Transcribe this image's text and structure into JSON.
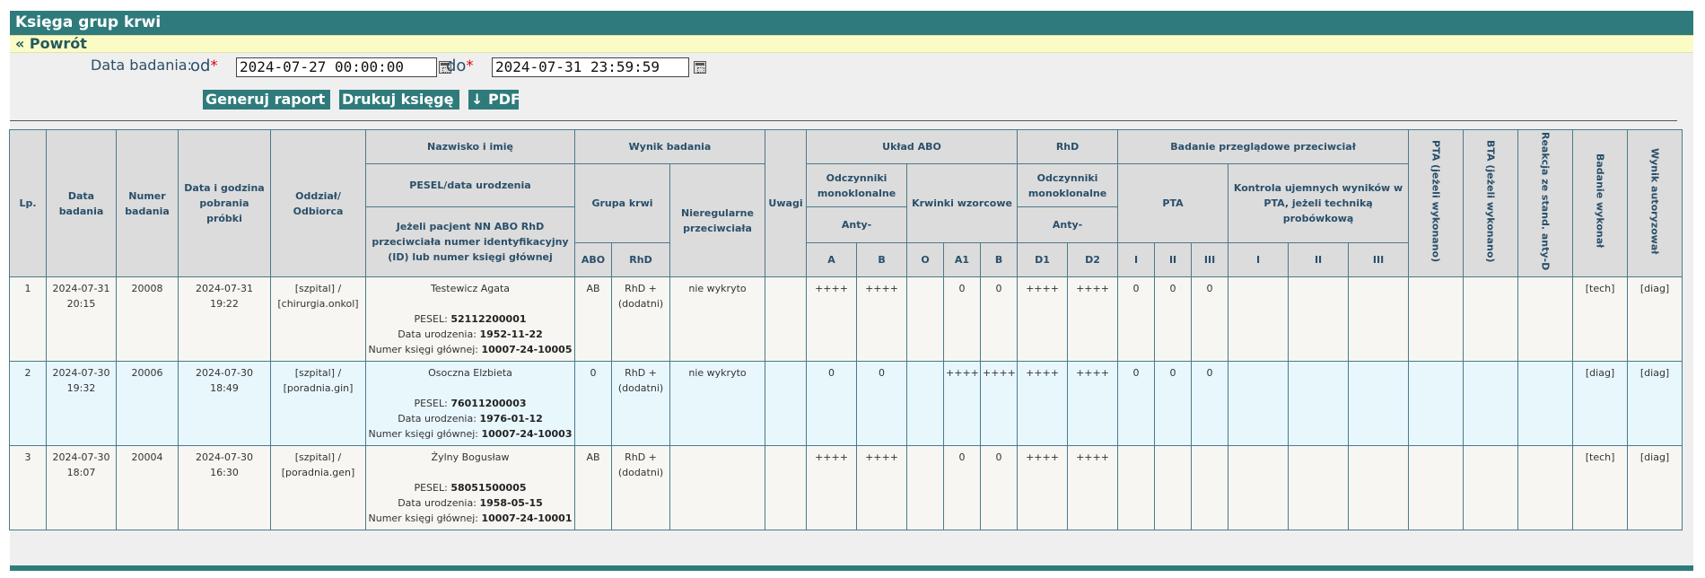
{
  "header": {
    "title": "Księga grup krwi",
    "back_label": "« Powrót"
  },
  "form": {
    "label": "Data badania:",
    "od_label": "od",
    "do_label": "do",
    "required_mark": "*",
    "date_from": "2024-07-27 00:00:00",
    "date_to": "2024-07-31 23:59:59",
    "calendar_icon": "calendar-icon"
  },
  "buttons": {
    "generate": "Generuj raport",
    "print": "Drukuj księgę",
    "pdf": "↓ PDF"
  },
  "table": {
    "h": {
      "lp": "Lp.",
      "data_badania": "Data badania",
      "numer_badania": "Numer badania",
      "data_pobrania": "Data i godzina pobrania próbki",
      "oddzial": "Oddział/ Odbiorca",
      "nazwisko": "Nazwisko i imię",
      "pesel": "PESEL/data urodzenia",
      "jezeli": "Jeżeli pacjent NN ABO RhD przeciwciała numer identyfikacyjny (ID) lub numer księgi głównej",
      "wynik_badania": "Wynik badania",
      "grupa_krwi": "Grupa krwi",
      "abo": "ABO",
      "rhd": "RhD",
      "nieregularne": "Nieregularne przeciwciała",
      "uwagi": "Uwagi",
      "uklad_abo": "Układ ABO",
      "odczynniki_mono": "Odczynniki monoklonalne",
      "anty": "Anty-",
      "a": "A",
      "b": "B",
      "krwinki": "Krwinki wzorcowe",
      "o": "O",
      "a1": "A1",
      "kb": "B",
      "rhd_group": "RhD",
      "odczynniki_mono_rhd": "Odczynniki monoklonalne",
      "anty_rhd": "Anty-",
      "d1": "D1",
      "d2": "D2",
      "badanie_przeglad": "Badanie przeglądowe przeciwciał",
      "pta": "PTA",
      "kontrola": "Kontrola ujemnych wyników w PTA, jeżeli techniką probówkową",
      "i": "I",
      "ii": "II",
      "iii": "III",
      "pta_wyk": "PTA (jeżeli wykonano)",
      "bta_wyk": "BTA (jeżeli wykonano)",
      "reakcja": "Reakcja ze stand. anty-D",
      "badanie_wykonal": "Badanie wykonał",
      "wynik_autoryzowal": "Wynik autoryzował"
    },
    "rows": [
      {
        "lp": "1",
        "date": "2024-07-31",
        "time": "20:15",
        "num": "20008",
        "pobranie": "2024-07-31 19:22",
        "szpital": "[szpital] /",
        "oddzial": "[chirurgia.onkol]",
        "name": "Testewicz Agata",
        "pesel_label": "PESEL:",
        "pesel": "52112200001",
        "dob_label": "Data urodzenia:",
        "dob": "1952-11-22",
        "book_label": "Numer księgi głównej:",
        "book": "10007-24-10005",
        "abo": "AB",
        "rhd1": "RhD +",
        "rhd2": "(dodatni)",
        "nieregularne": "nie wykryto",
        "uwagi": "",
        "a": "++++",
        "b": "++++",
        "o": "",
        "a1": "0",
        "kb": "0",
        "d1": "++++",
        "d2": "++++",
        "pta1": "0",
        "pta2": "0",
        "pta3": "0",
        "k1": "",
        "k2": "",
        "k3": "",
        "pta_wyk": "",
        "bta_wyk": "",
        "reakcja": "",
        "wykonal": "[tech]",
        "autoryzowal": "[diag]"
      },
      {
        "lp": "2",
        "date": "2024-07-30",
        "time": "19:32",
        "num": "20006",
        "pobranie": "2024-07-30 18:49",
        "szpital": "[szpital] /",
        "oddzial": "[poradnia.gin]",
        "name": "Osoczna Elzbieta",
        "pesel_label": "PESEL:",
        "pesel": "76011200003",
        "dob_label": "Data urodzenia:",
        "dob": "1976-01-12",
        "book_label": "Numer księgi głównej:",
        "book": "10007-24-10003",
        "abo": "0",
        "rhd1": "RhD +",
        "rhd2": "(dodatni)",
        "nieregularne": "nie wykryto",
        "uwagi": "",
        "a": "0",
        "b": "0",
        "o": "",
        "a1": "++++",
        "kb": "++++",
        "d1": "++++",
        "d2": "++++",
        "pta1": "0",
        "pta2": "0",
        "pta3": "0",
        "k1": "",
        "k2": "",
        "k3": "",
        "pta_wyk": "",
        "bta_wyk": "",
        "reakcja": "",
        "wykonal": "[diag]",
        "autoryzowal": "[diag]"
      },
      {
        "lp": "3",
        "date": "2024-07-30",
        "time": "18:07",
        "num": "20004",
        "pobranie": "2024-07-30 16:30",
        "szpital": "[szpital] /",
        "oddzial": "[poradnia.gen]",
        "name": "Żylny Bogusław",
        "pesel_label": "PESEL:",
        "pesel": "58051500005",
        "dob_label": "Data urodzenia:",
        "dob": "1958-05-15",
        "book_label": "Numer księgi głównej:",
        "book": "10007-24-10001",
        "abo": "AB",
        "rhd1": "RhD +",
        "rhd2": "(dodatni)",
        "nieregularne": "",
        "uwagi": "",
        "a": "++++",
        "b": "++++",
        "o": "",
        "a1": "0",
        "kb": "0",
        "d1": "++++",
        "d2": "++++",
        "pta1": "",
        "pta2": "",
        "pta3": "",
        "k1": "",
        "k2": "",
        "k3": "",
        "pta_wyk": "",
        "bta_wyk": "",
        "reakcja": "",
        "wykonal": "[tech]",
        "autoryzowal": "[diag]"
      }
    ]
  },
  "colors": {
    "header_bg": "#2f7b7b",
    "back_bg": "#fbfbc6",
    "row_even": "#e8f7fc",
    "row_odd": "#f7f6f2",
    "header_text": "#2a4f6a"
  }
}
